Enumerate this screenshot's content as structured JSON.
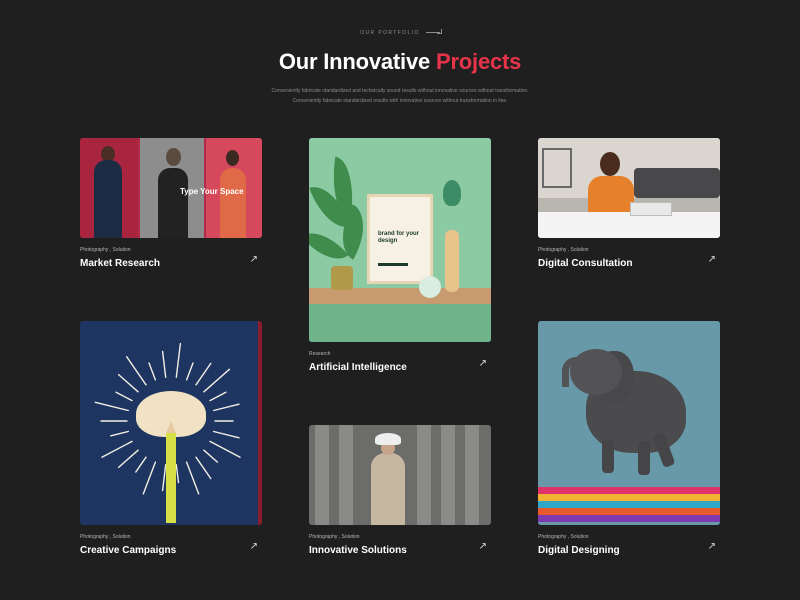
{
  "header": {
    "eyebrow": "OUR PORTFOLIO",
    "title_main": "Our Innovative ",
    "title_accent": "Projects",
    "subtitle_line1": "Conveniently fabricate standardized and technically sound results without innovative sources without transformation.",
    "subtitle_line2": "Conveniently fabricate standardized results with innovative sources without transformation in line."
  },
  "colors": {
    "background": "#1f1f20",
    "accent": "#e8344a",
    "text": "#ffffff",
    "muted": "#8b8b8b"
  },
  "projects": [
    {
      "meta": "Photography , Solution",
      "title": "Market Research",
      "arrow_icon": "arrow-up-right-icon",
      "image_text": "Type Your Space"
    },
    {
      "meta": "Research",
      "title": "Artificial Intelligence",
      "arrow_icon": "arrow-up-right-icon",
      "image_text": "brand for your design"
    },
    {
      "meta": "Photography , Solution",
      "title": "Digital Consultation",
      "arrow_icon": "arrow-up-right-icon"
    },
    {
      "meta": "Photography , Solution",
      "title": "Creative Campaigns",
      "arrow_icon": "arrow-up-right-icon"
    },
    {
      "meta": "Photography , Solution",
      "title": "Innovative Solutions",
      "arrow_icon": "arrow-up-right-icon"
    },
    {
      "meta": "Photography , Solution",
      "title": "Digital Designing",
      "arrow_icon": "arrow-up-right-icon"
    }
  ],
  "icons": {
    "arrow": "↗"
  }
}
